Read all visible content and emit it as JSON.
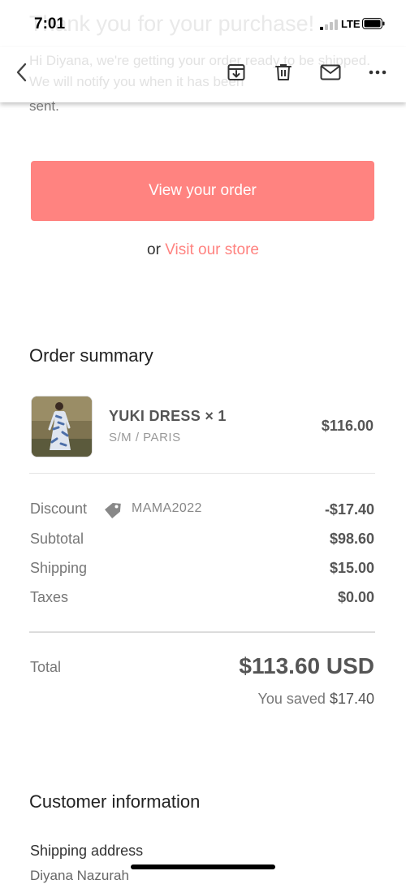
{
  "background": {
    "title": "Thank you for your purchase!",
    "body": "Hi Diyana, we're getting your order ready to be shipped. We will notify you when it has been",
    "body_tail": "sent."
  },
  "status_bar": {
    "time": "7:01",
    "network": "LTE"
  },
  "toolbar": {
    "back_icon": "chevron-left-icon",
    "actions": [
      "archive-icon",
      "trash-icon",
      "mail-icon",
      "more-icon"
    ]
  },
  "cta": {
    "primary_label": "View your order",
    "or_text": "or",
    "store_link": "Visit our store",
    "accent": "#ff8380"
  },
  "order_summary": {
    "heading": "Order summary",
    "item": {
      "name": "YUKI DRESS × 1",
      "variant": "S/M / PARIS",
      "price": "$116.00"
    },
    "discount": {
      "label": "Discount",
      "code": "MAMA2022",
      "value": "-$17.40"
    },
    "subtotal": {
      "label": "Subtotal",
      "value": "$98.60"
    },
    "shipping": {
      "label": "Shipping",
      "value": "$15.00"
    },
    "taxes": {
      "label": "Taxes",
      "value": "$0.00"
    },
    "total": {
      "label": "Total",
      "value": "$113.60 USD"
    },
    "saved": {
      "text": "You saved",
      "value": "$17.40"
    }
  },
  "customer_info": {
    "heading": "Customer information",
    "shipping_address_label": "Shipping address",
    "name": "Diyana Nazurah"
  }
}
